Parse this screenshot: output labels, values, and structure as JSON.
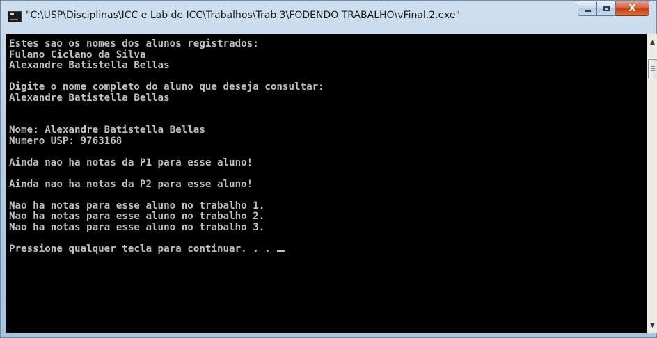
{
  "window": {
    "title": "\"C:\\USP\\Disciplinas\\ICC e Lab de ICC\\Trabalhos\\Trab 3\\FODENDO TRABALHO\\vFinal.2.exe\"",
    "minimize_symbol": "",
    "maximize_symbol": "",
    "close_symbol": "X"
  },
  "console": {
    "lines": [
      "Estes sao os nomes dos alunos registrados:",
      "Fulano Ciclano da Silva",
      "Alexandre Batistella Bellas",
      "",
      "Digite o nome completo do aluno que deseja consultar:",
      "Alexandre Batistella Bellas",
      "",
      "",
      "Nome: Alexandre Batistella Bellas",
      "Numero USP: 9763168",
      "",
      "Ainda nao ha notas da P1 para esse aluno!",
      "",
      "Ainda nao ha notas da P2 para esse aluno!",
      "",
      "Nao ha notas para esse aluno no trabalho 1.",
      "Nao ha notas para esse aluno no trabalho 2.",
      "Nao ha notas para esse aluno no trabalho 3.",
      "",
      "Pressione qualquer tecla para continuar. . . "
    ]
  },
  "scrollbar": {
    "up_arrow": "▲",
    "down_arrow": "▼"
  },
  "colors": {
    "console_bg": "#000000",
    "console_text": "#c0c0c0",
    "close_button": "#c23d17"
  }
}
